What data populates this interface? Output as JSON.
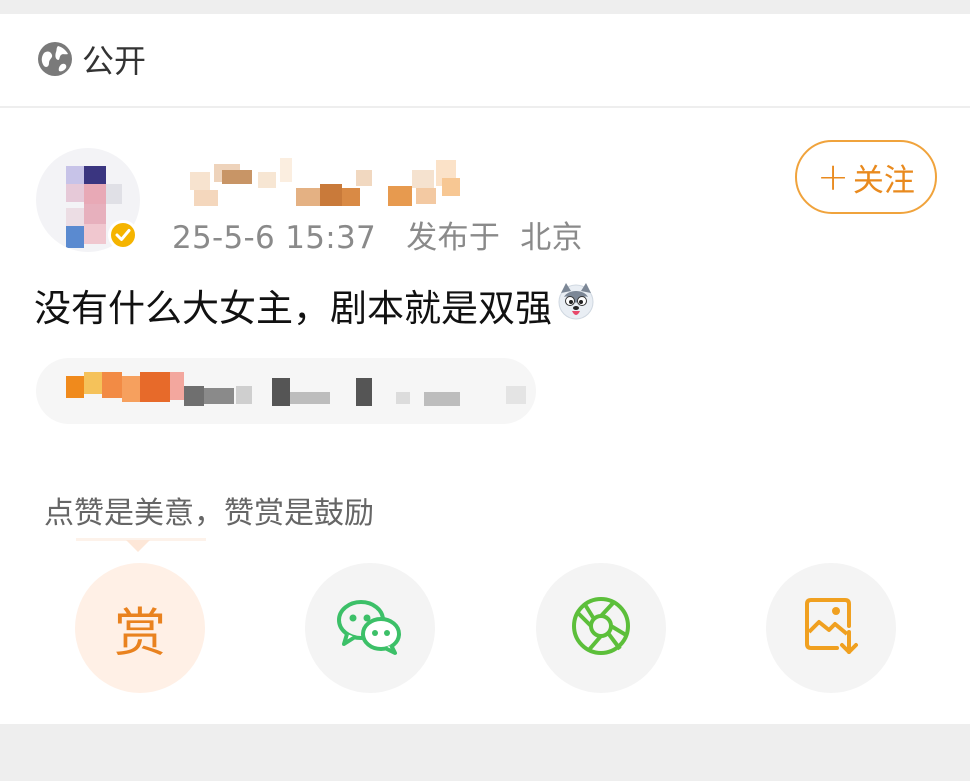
{
  "visibility": {
    "label": "公开",
    "icon": "globe-icon"
  },
  "post": {
    "timestamp": "25-5-6 15:37",
    "location_prefix": "发布于",
    "location": "北京",
    "text": "没有什么大女主，剧本就是双强"
  },
  "follow_button": {
    "plus": "+",
    "label": "关注"
  },
  "reward": {
    "tip": "点赞是美意，赞赏是鼓励",
    "button_char": "赏"
  },
  "share_actions": [
    {
      "name": "wechat",
      "icon": "wechat-icon"
    },
    {
      "name": "moments",
      "icon": "moments-icon"
    },
    {
      "name": "save-image",
      "icon": "save-image-icon"
    }
  ],
  "colors": {
    "accent": "#e98a1e",
    "wechat_green": "#3cc068",
    "moments_green": "#5cbf3a",
    "save_orange": "#f0a020"
  }
}
